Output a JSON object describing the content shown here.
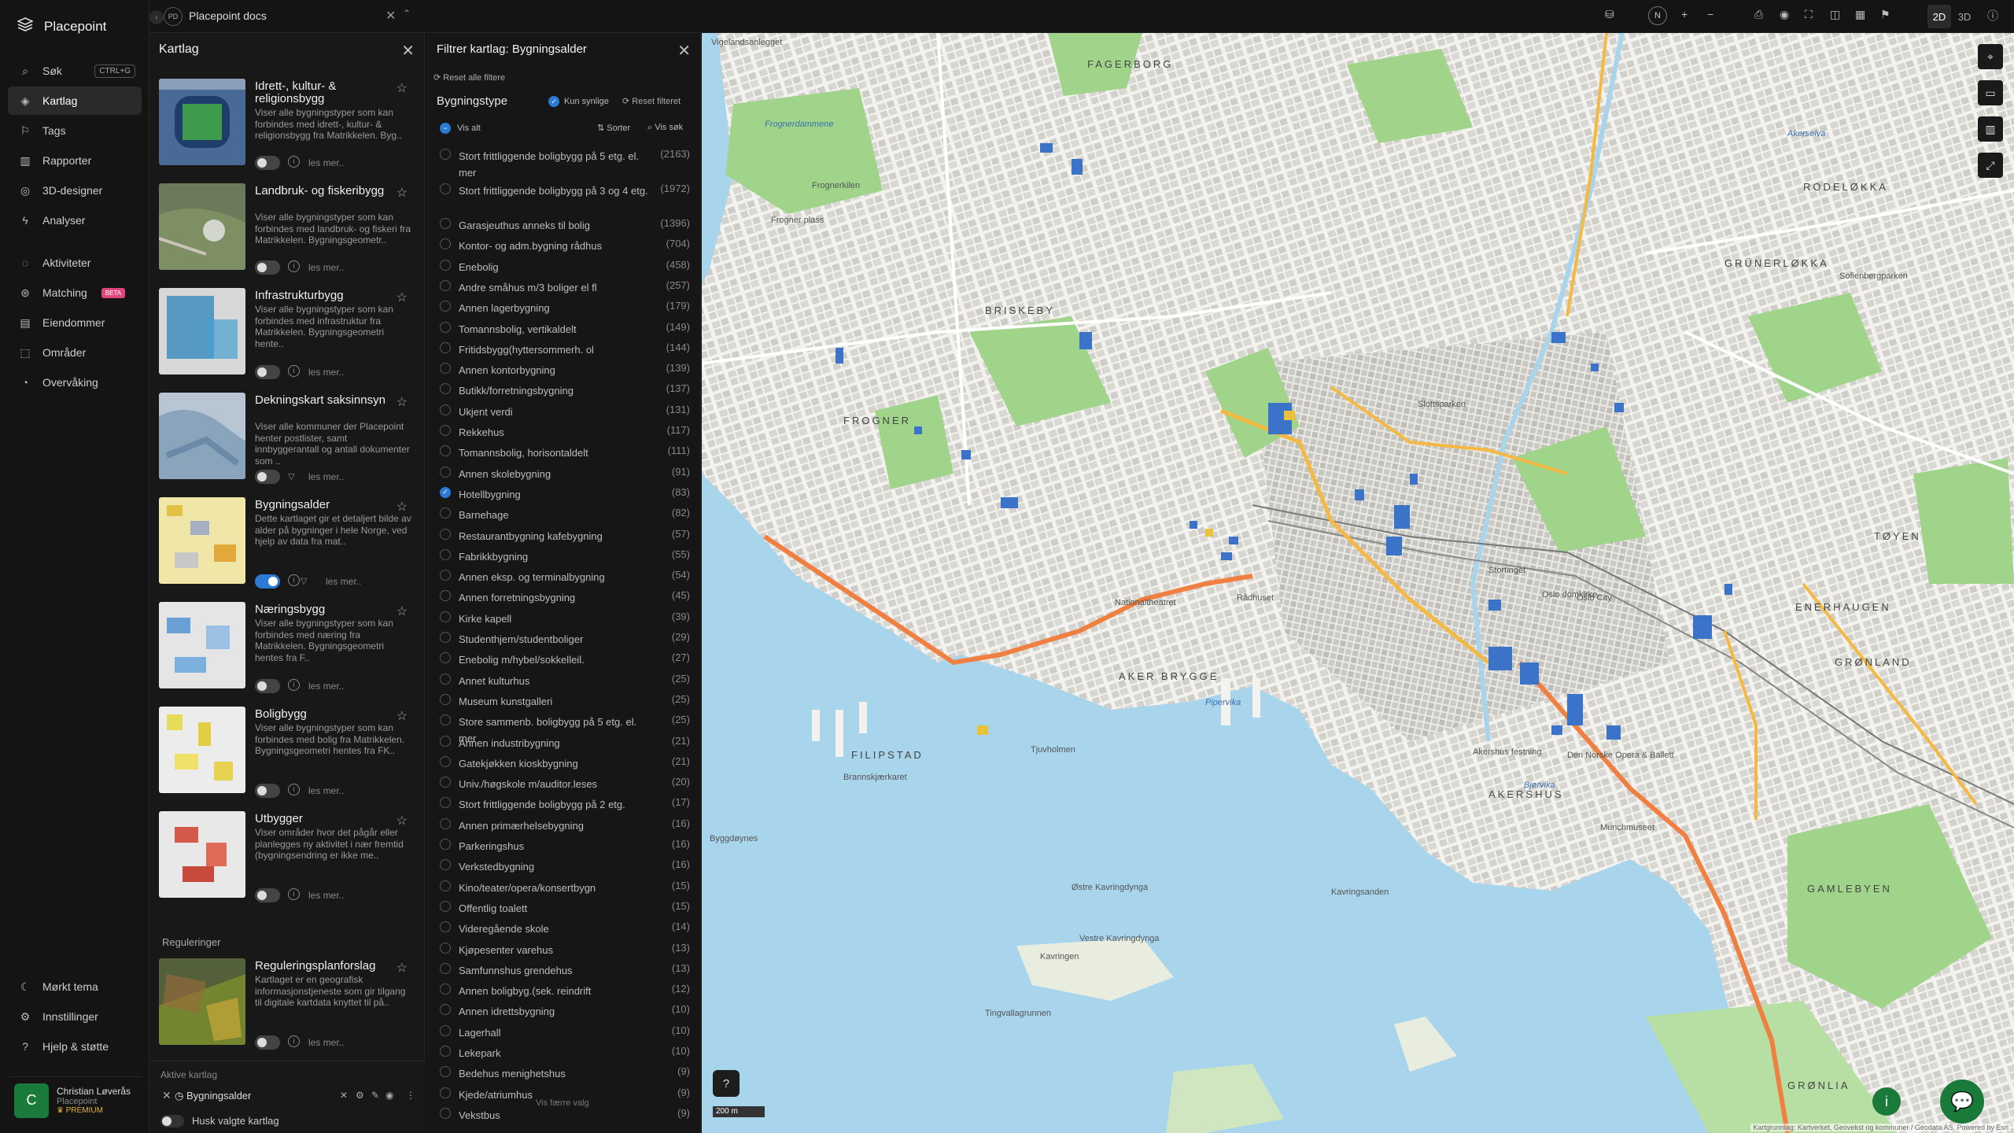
{
  "app": {
    "name": "Placepoint"
  },
  "nav": {
    "items": [
      {
        "label": "Søk",
        "icon": "search-icon",
        "shortcut": "CTRL+G"
      },
      {
        "label": "Kartlag",
        "icon": "layers-icon",
        "active": true
      },
      {
        "label": "Tags",
        "icon": "bookmark-icon"
      },
      {
        "label": "Rapporter",
        "icon": "bar-chart-icon"
      },
      {
        "label": "3D-designer",
        "icon": "cube-icon"
      },
      {
        "label": "Analyser",
        "icon": "bolt-icon"
      },
      {
        "label": "Aktiviteter",
        "icon": "chat-icon"
      },
      {
        "label": "Matching",
        "icon": "match-icon",
        "badge": "BETA"
      },
      {
        "label": "Eiendommer",
        "icon": "building-icon"
      },
      {
        "label": "Områder",
        "icon": "area-icon"
      },
      {
        "label": "Overvåking",
        "icon": "pulse-icon"
      }
    ],
    "bottom": [
      {
        "label": "Mørkt tema",
        "icon": "moon-icon"
      },
      {
        "label": "Innstillinger",
        "icon": "gear-icon"
      },
      {
        "label": "Hjelp & støtte",
        "icon": "help-icon"
      }
    ],
    "user": {
      "initial": "C",
      "name": "Christian Løverås",
      "org": "Placepoint",
      "plan": "PREMIUM"
    }
  },
  "topbar": {
    "doc_badge": "PD",
    "doc_title": "Placepoint docs",
    "north": "N",
    "mode_2d": "2D",
    "mode_3d": "3D"
  },
  "kartlag": {
    "title": "Kartlag",
    "cards": [
      {
        "title": "Idrett-, kultur- & religionsbygg",
        "desc": "Viser alle bygningstyper som kan forbindes med idrett-, kultur- & religionsbygg fra Matrikkelen. Byg..",
        "more": "les mer..",
        "enabled": false
      },
      {
        "title": "Landbruk- og fiskeribygg",
        "desc": "Viser alle bygningstyper som kan forbindes med landbruk- og fiskeri fra Matrikkelen. Bygningsgeometr..",
        "more": "les mer..",
        "enabled": false
      },
      {
        "title": "Infrastrukturbygg",
        "desc": "Viser alle bygningstyper som kan forbindes med infrastruktur fra Matrikkelen. Bygningsgeometri hente..",
        "more": "les mer..",
        "enabled": false
      },
      {
        "title": "Dekningskart saksinnsyn",
        "desc": "Viser alle kommuner der Placepoint henter postlister, samt innbyggerantall og antall dokumenter som ..",
        "more": "les mer..",
        "enabled": false
      },
      {
        "title": "Bygningsalder",
        "desc": "Dette kartlaget gir et detaljert bilde av alder på bygninger i hele Norge, ved hjelp av data fra mat..",
        "more": "les mer..",
        "enabled": true
      },
      {
        "title": "Næringsbygg",
        "desc": "Viser alle bygningstyper som kan forbindes med næring fra Matrikkelen. Bygningsgeometri hentes fra F..",
        "more": "les mer..",
        "enabled": false
      },
      {
        "title": "Boligbygg",
        "desc": "Viser alle bygningstyper som kan forbindes med bolig fra Matrikkelen. Bygningsgeometri hentes fra FK..",
        "more": "les mer..",
        "enabled": false
      },
      {
        "title": "Utbygger",
        "desc": "Viser områder hvor det pågår eller planlegges ny aktivitet i nær fremtid (bygningsendring er ikke me..",
        "more": "les mer..",
        "enabled": false
      }
    ],
    "section_reguleringer": "Reguleringer",
    "reg_card": {
      "title": "Reguleringsplanforslag",
      "desc": "Kartlaget er en geografisk informasjonstjeneste som gir tilgang til digitale kartdata knyttet til på..",
      "more": "les mer..",
      "enabled": false
    },
    "active_title": "Aktive kartlag",
    "active_layer": "Bygningsalder",
    "remember": "Husk valgte kartlag"
  },
  "filter": {
    "title": "Filtrer kartlag: Bygningsalder",
    "reset_all": "Reset alle filtere",
    "section": "Bygningstype",
    "only_visible": "Kun synlige",
    "reset": "Reset filteret",
    "show_all": "Vis alt",
    "sort": "Sorter",
    "search": "Vis søk",
    "show_fewer": "Vis færre valg",
    "rows": [
      {
        "label": "Stort frittliggende boligbygg på 5 etg. el. mer",
        "count": "(2163)",
        "checked": false
      },
      {
        "label": "Stort frittliggende boligbygg på 3 og 4 etg.",
        "count": "(1972)",
        "checked": false
      },
      {
        "label": "Garasjeuthus anneks til bolig",
        "count": "(1396)",
        "checked": false
      },
      {
        "label": "Kontor- og adm.bygning rådhus",
        "count": "(704)",
        "checked": false
      },
      {
        "label": "Enebolig",
        "count": "(458)",
        "checked": false
      },
      {
        "label": "Andre småhus m/3 boliger el fl",
        "count": "(257)",
        "checked": false
      },
      {
        "label": "Annen lagerbygning",
        "count": "(179)",
        "checked": false
      },
      {
        "label": "Tomannsbolig, vertikaldelt",
        "count": "(149)",
        "checked": false
      },
      {
        "label": "Fritidsbygg(hyttersommerh. ol",
        "count": "(144)",
        "checked": false
      },
      {
        "label": "Annen kontorbygning",
        "count": "(139)",
        "checked": false
      },
      {
        "label": "Butikk/forretningsbygning",
        "count": "(137)",
        "checked": false
      },
      {
        "label": "Ukjent verdi",
        "count": "(131)",
        "checked": false
      },
      {
        "label": "Rekkehus",
        "count": "(117)",
        "checked": false
      },
      {
        "label": "Tomannsbolig, horisontaldelt",
        "count": "(111)",
        "checked": false
      },
      {
        "label": "Annen skolebygning",
        "count": "(91)",
        "checked": false
      },
      {
        "label": "Hotellbygning",
        "count": "(83)",
        "checked": true
      },
      {
        "label": "Barnehage",
        "count": "(82)",
        "checked": false
      },
      {
        "label": "Restaurantbygning kafebygning",
        "count": "(57)",
        "checked": false
      },
      {
        "label": "Fabrikkbygning",
        "count": "(55)",
        "checked": false
      },
      {
        "label": "Annen eksp. og terminalbygning",
        "count": "(54)",
        "checked": false
      },
      {
        "label": "Annen forretningsbygning",
        "count": "(45)",
        "checked": false
      },
      {
        "label": "Kirke kapell",
        "count": "(39)",
        "checked": false
      },
      {
        "label": "Studenthjem/studentboliger",
        "count": "(29)",
        "checked": false
      },
      {
        "label": "Enebolig m/hybel/sokkelleil.",
        "count": "(27)",
        "checked": false
      },
      {
        "label": "Annet kulturhus",
        "count": "(25)",
        "checked": false
      },
      {
        "label": "Museum kunstgalleri",
        "count": "(25)",
        "checked": false
      },
      {
        "label": "Store sammenb. boligbygg på 5 etg. el. mer",
        "count": "(25)",
        "checked": false
      },
      {
        "label": "Annen industribygning",
        "count": "(21)",
        "checked": false
      },
      {
        "label": "Gatekjøkken kioskbygning",
        "count": "(21)",
        "checked": false
      },
      {
        "label": "Univ./høgskole m/auditor.leses",
        "count": "(20)",
        "checked": false
      },
      {
        "label": "Stort frittliggende boligbygg på 2 etg.",
        "count": "(17)",
        "checked": false
      },
      {
        "label": "Annen primærhelsebygning",
        "count": "(16)",
        "checked": false
      },
      {
        "label": "Parkeringshus",
        "count": "(16)",
        "checked": false
      },
      {
        "label": "Verkstedbygning",
        "count": "(16)",
        "checked": false
      },
      {
        "label": "Kino/teater/opera/konsertbygn",
        "count": "(15)",
        "checked": false
      },
      {
        "label": "Offentlig toalett",
        "count": "(15)",
        "checked": false
      },
      {
        "label": "Videregående skole",
        "count": "(14)",
        "checked": false
      },
      {
        "label": "Kjøpesenter varehus",
        "count": "(13)",
        "checked": false
      },
      {
        "label": "Samfunnshus grendehus",
        "count": "(13)",
        "checked": false
      },
      {
        "label": "Annen boligbyg.(sek. reindrift",
        "count": "(12)",
        "checked": false
      },
      {
        "label": "Annen idrettsbygning",
        "count": "(10)",
        "checked": false
      },
      {
        "label": "Lagerhall",
        "count": "(10)",
        "checked": false
      },
      {
        "label": "Lekepark",
        "count": "(10)",
        "checked": false
      },
      {
        "label": "Bedehus menighetshus",
        "count": "(9)",
        "checked": false
      },
      {
        "label": "Kjede/atriumhus",
        "count": "(9)",
        "checked": false
      },
      {
        "label": "Vekstbus",
        "count": "(9)",
        "checked": false
      }
    ]
  },
  "map": {
    "scale": "200 m",
    "attribution": "Kartgrunnlag: Kartverket, Geovekst og kommuner / Geodata AS, Powered by Esri",
    "labels": [
      {
        "t": "FAGERBORG",
        "big": true
      },
      {
        "t": "RODELØKKA",
        "big": true
      },
      {
        "t": "GRÜNERLØKKA",
        "big": true
      },
      {
        "t": "BRISKEBY",
        "big": true
      },
      {
        "t": "FROGNER",
        "big": true
      },
      {
        "t": "AKER BRYGGE",
        "big": true
      },
      {
        "t": "FILIPSTAD",
        "big": true
      },
      {
        "t": "AKERSHUS",
        "big": true
      },
      {
        "t": "TØYEN",
        "big": true
      },
      {
        "t": "ENERHAUGEN",
        "big": true
      },
      {
        "t": "GRØNLAND",
        "big": true
      },
      {
        "t": "GAMLEBYEN",
        "big": true
      },
      {
        "t": "GRØNLIA",
        "big": true
      },
      {
        "t": "Akerselva",
        "water": true
      },
      {
        "t": "Frognerdammene",
        "water": true
      },
      {
        "t": "Pipervika",
        "water": true
      },
      {
        "t": "Bjørvika",
        "water": true
      },
      {
        "t": "Kavringsanden"
      },
      {
        "t": "Østre Kavringdynga"
      },
      {
        "t": "Vestre Kavringdynga"
      },
      {
        "t": "Kavringen"
      },
      {
        "t": "Tingvallagrunnen"
      },
      {
        "t": "Byggdøynes"
      },
      {
        "t": "Brannskjærkaret"
      },
      {
        "t": "Frognerkilen"
      },
      {
        "t": "Tjuvholmen"
      },
      {
        "t": "Akershus festning"
      },
      {
        "t": "Slottsparken"
      },
      {
        "t": "Oslo City"
      },
      {
        "t": "Oslo domkirke"
      },
      {
        "t": "Nationaltheatret"
      },
      {
        "t": "Rådhuset"
      },
      {
        "t": "Stortinget"
      },
      {
        "t": "Frogner plass"
      },
      {
        "t": "Vigelandsanlegget"
      },
      {
        "t": "Sofienbergparken"
      },
      {
        "t": "Munchmuseet"
      },
      {
        "t": "Den Norske Opera & Ballett"
      }
    ]
  }
}
